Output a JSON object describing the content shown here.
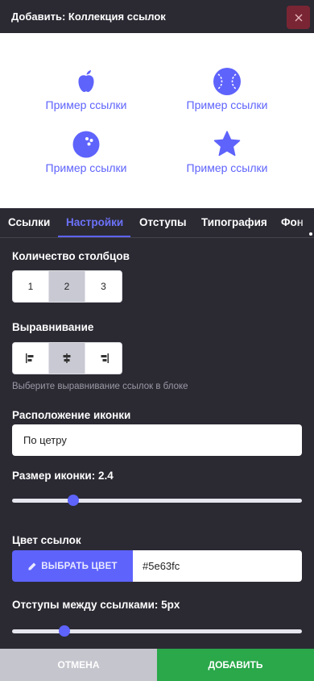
{
  "header": {
    "title": "Добавить: Коллекция ссылок"
  },
  "preview": {
    "links": [
      {
        "label": "Пример ссылки",
        "icon": "apple-icon"
      },
      {
        "label": "Пример ссылки",
        "icon": "baseball-icon"
      },
      {
        "label": "Пример ссылки",
        "icon": "bowling-ball-icon"
      },
      {
        "label": "Пример ссылки",
        "icon": "star-icon"
      }
    ]
  },
  "tabs": [
    {
      "label": "Ссылки",
      "active": false
    },
    {
      "label": "Настройки",
      "active": true
    },
    {
      "label": "Отступы",
      "active": false
    },
    {
      "label": "Типография",
      "active": false
    },
    {
      "label": "Фон",
      "active": false
    }
  ],
  "settings": {
    "columns": {
      "label": "Количество столбцов",
      "options": [
        "1",
        "2",
        "3"
      ],
      "selected": "2"
    },
    "alignment": {
      "label": "Выравнивание",
      "options": [
        "align-left-icon",
        "align-center-icon",
        "align-right-icon"
      ],
      "selected": "align-center-icon",
      "hint": "Выберите выравнивание ссылок в блоке"
    },
    "icon_position": {
      "label": "Расположение иконки",
      "value": "По цетру"
    },
    "icon_size": {
      "label": "Размер иконки: 2.4",
      "slider_fraction": 0.21
    },
    "link_color": {
      "label": "Цвет ссылок",
      "button_label": "ВЫБРАТЬ ЦВЕТ",
      "value": "#5e63fc"
    },
    "link_spacing": {
      "label": "Отступы между ссылками: 5px",
      "slider_fraction": 0.18
    }
  },
  "footer": {
    "cancel_label": "ОТМЕНА",
    "add_label": "ДОБАВИТЬ"
  },
  "colors": {
    "accent": "#5e63fc",
    "add_button": "#2aa84a",
    "cancel_button": "#c5c5cd",
    "close_button": "#7a2533",
    "background": "#2b2a33"
  }
}
